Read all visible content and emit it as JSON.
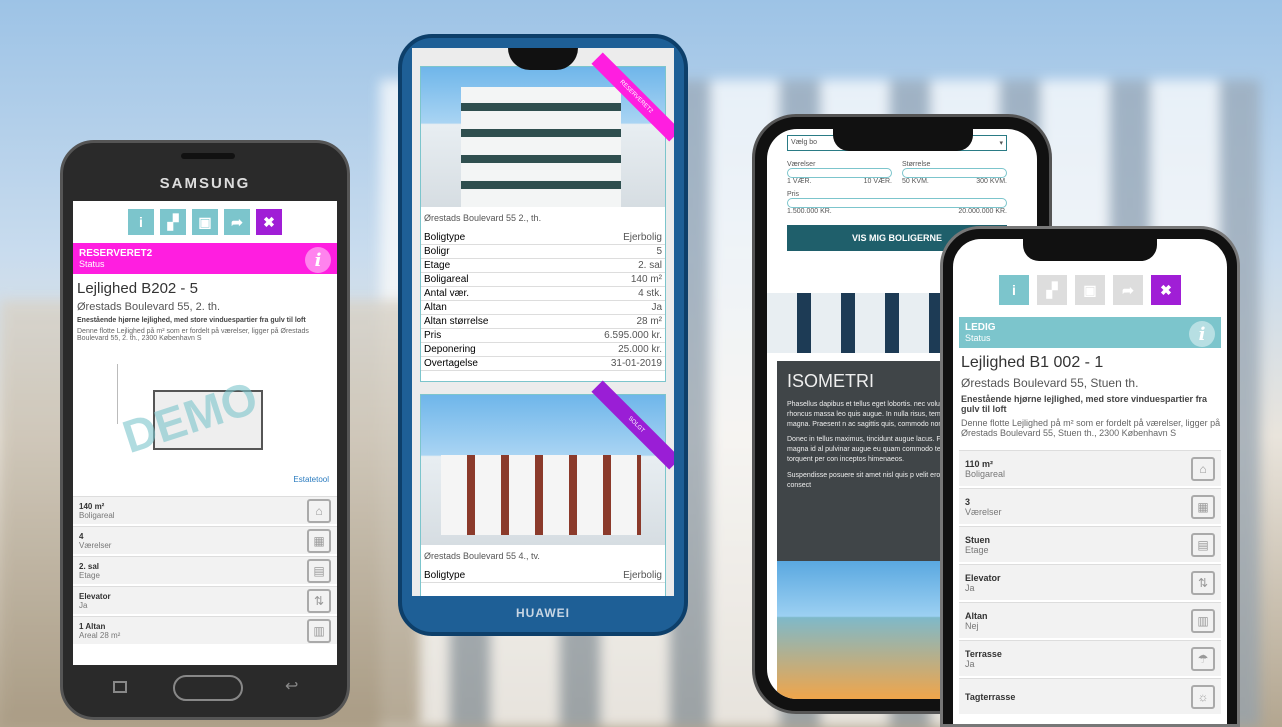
{
  "phone_left": {
    "brand": "SAMSUNG",
    "status_label": "RESERVERET2",
    "status_caption": "Status",
    "status_color": "#ff1ee0",
    "title": "Lejlighed B202 - 5",
    "address": "Ørestads Boulevard 55, 2. th.",
    "lead": "Enestående hjørne lejlighed, med store vinduespartier fra gulv til loft",
    "description": "Denne flotte Lejlighed på m² som er fordelt på værelser, ligger på Ørestads Boulevard 55, 2. th., 2300 København S",
    "watermark": "DEMO",
    "plan_brand": "Estatetool",
    "features": [
      {
        "value": "140 m²",
        "label": "Boligareal",
        "icon": "house-icon"
      },
      {
        "value": "4",
        "label": "Værelser",
        "icon": "rooms-icon"
      },
      {
        "value": "2. sal",
        "label": "Etage",
        "icon": "floor-icon"
      },
      {
        "value": "Elevator",
        "label": "Ja",
        "icon": "elevator-icon"
      },
      {
        "value": "1 Altan",
        "label": "Areal 28 m²",
        "icon": "balcony-icon"
      }
    ]
  },
  "phone_huawei": {
    "brand": "HUAWEI",
    "card1": {
      "ribbon": "RESERVERET2",
      "ribbon_color": "#ff1ee0",
      "address": "Ørestads Boulevard 55 2., th.",
      "rows": [
        {
          "k": "Boligtype",
          "v": "Ejerbolig"
        },
        {
          "k": "Boligr",
          "v": "5"
        },
        {
          "k": "Etage",
          "v": "2. sal"
        },
        {
          "k": "Boligareal",
          "v": "140 m²"
        },
        {
          "k": "Antal vær.",
          "v": "4 stk."
        },
        {
          "k": "Altan",
          "v": "Ja"
        },
        {
          "k": "Altan størrelse",
          "v": "28 m²"
        },
        {
          "k": "Pris",
          "v": "6.595.000 kr."
        },
        {
          "k": "Deponering",
          "v": "25.000 kr."
        },
        {
          "k": "Overtagelse",
          "v": "31-01-2019"
        }
      ]
    },
    "card2": {
      "ribbon": "SOLGT",
      "ribbon_color": "#9a1ed6",
      "address": "Ørestads Boulevard 55 4., tv.",
      "rows": [
        {
          "k": "Boligtype",
          "v": "Ejerbolig"
        }
      ]
    }
  },
  "phone_iphone_back": {
    "select_placeholder": "Vælg bo",
    "rooms_label": "Værelser",
    "rooms_min": "1 VÆR.",
    "rooms_max": "10 VÆR.",
    "size_label": "Størrelse",
    "size_min": "50 KVM.",
    "size_max": "300 KVM.",
    "price_label": "Pris",
    "price_min": "1.500.000 KR.",
    "price_max": "20.000.000 KR.",
    "cta": "VIS MIG BOLIGERNE",
    "section_title": "ISOMETRI",
    "para1": "Phasellus dapibus et tellus eget lobortis. nec volutpat euismod, mi enim rhoncus massa leo quis augue. In nulla risus, tem egestas et, tempus et magna. Praesent n ac sagittis quis, commodo non justo.",
    "para2": "Donec in tellus maximus, tincidunt augue lacus. Fusce sagittis pharetra magna id al pulvinar augue eu quam commodo temp taciti sociosqu ad litora torquent per con inceptos himenaeos.",
    "para3": "Suspendisse posuere sit amet nisl quis p velit eros, pretium vel laoreet at, consect"
  },
  "phone_iphone_front": {
    "status_label": "LEDIG",
    "status_caption": "Status",
    "status_color": "#7cc5cc",
    "title": "Lejlighed B1 002 - 1",
    "address": "Ørestads Boulevard 55, Stuen th.",
    "lead": "Enestående hjørne lejlighed, med store vinduespartier fra gulv til loft",
    "description": "Denne flotte Lejlighed på m² som er fordelt på værelser, ligger på Ørestads Boulevard 55, Stuen th., 2300 København S",
    "features": [
      {
        "value": "110 m²",
        "label": "Boligareal",
        "icon": "house-icon"
      },
      {
        "value": "3",
        "label": "Værelser",
        "icon": "rooms-icon"
      },
      {
        "value": "Stuen",
        "label": "Etage",
        "icon": "floor-icon"
      },
      {
        "value": "Elevator",
        "label": "Ja",
        "icon": "elevator-icon"
      },
      {
        "value": "Altan",
        "label": "Nej",
        "icon": "balcony-icon"
      },
      {
        "value": "Terrasse",
        "label": "Ja",
        "icon": "parasol-icon"
      },
      {
        "value": "Tagterrasse",
        "label": "",
        "icon": "sun-icon"
      }
    ]
  },
  "toolbar_icons": [
    "info-icon",
    "floorplan-icon",
    "image-icon",
    "share-icon",
    "close-icon"
  ]
}
